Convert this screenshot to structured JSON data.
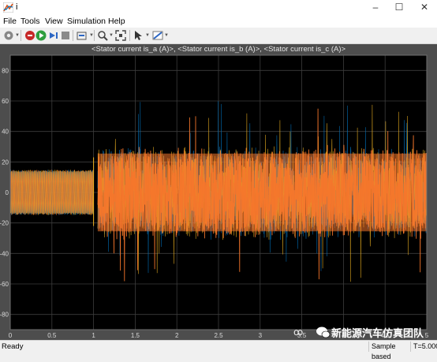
{
  "window": {
    "title": "i"
  },
  "menu": [
    "File",
    "Tools",
    "View",
    "Simulation",
    "Help"
  ],
  "toolbar": {
    "icons": [
      "gear-icon",
      "stop-icon",
      "step-back-icon",
      "run-icon",
      "step-forward-icon",
      "stop-square-icon",
      "zoom-icon",
      "fit-icon",
      "cursor-icon",
      "highlight-icon"
    ]
  },
  "chart_data": {
    "type": "line",
    "title": "<Stator current is_a (A)>, <Stator current is_b (A)>, <Stator current is_c (A)>",
    "xlabel": "",
    "ylabel": "",
    "xlim": [
      0,
      5
    ],
    "ylim": [
      -90,
      90
    ],
    "x_ticks": [
      "0",
      "0.5",
      "1",
      "1.5",
      "2",
      "2.5",
      "3",
      "3.5",
      "4",
      "4.5",
      "5"
    ],
    "y_ticks": [
      "80",
      "60",
      "40",
      "20",
      "0",
      "-20",
      "-40",
      "-60",
      "-80"
    ],
    "grid": true,
    "series": [
      {
        "color": "#0072bd",
        "segments": [
          {
            "x": [
              0,
              1.0
            ],
            "band": [
              -15,
              15
            ]
          },
          {
            "x": [
              1.05,
              5
            ],
            "band": [
              -30,
              30
            ],
            "peaks_max": 60,
            "peaks_min": -45
          }
        ]
      },
      {
        "color": "#edb120"
      },
      {
        "color": "#f5762b"
      }
    ],
    "colors": {
      "background": "#000000",
      "frame": "#4d4d4d",
      "grid": "#3c3c3c",
      "tick_text": "#d9d9d9"
    }
  },
  "status": {
    "ready": "Ready",
    "mode": "Sample based",
    "time": "T=5.000"
  },
  "watermark": {
    "text": "新能源汽车仿真团队"
  }
}
